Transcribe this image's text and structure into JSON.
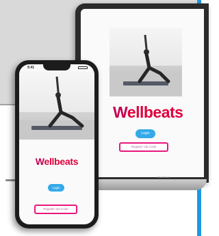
{
  "brand": {
    "name": "Wellbeats",
    "first_letter": "W",
    "rest": "ellbeats"
  },
  "buttons": {
    "login": "Login",
    "register": "Register Via Code"
  },
  "phone": {
    "time": "9:41"
  },
  "laptop": {
    "badge": "MacBook"
  },
  "colors": {
    "brand_pink": "#e0003d",
    "register_outline": "#e8177b",
    "login_blue": "#35a9e8",
    "accent_rule": "#1e9ae0"
  },
  "images": [
    "yoga-pose-photo-laptop",
    "yoga-pose-photo-phone"
  ]
}
